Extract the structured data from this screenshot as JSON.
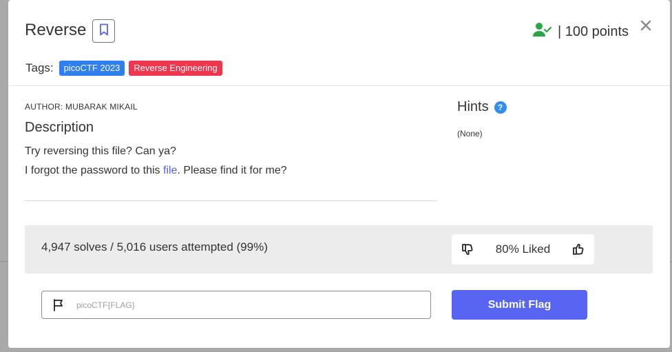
{
  "challenge": {
    "title": "Reverse",
    "points_label": "| 100 points",
    "tags_label": "Tags:",
    "tags": [
      {
        "label": "picoCTF 2023",
        "color": "#2f7ff0"
      },
      {
        "label": "Reverse Engineering",
        "color": "#f0364e"
      }
    ],
    "author": "AUTHOR: MUBARAK MIKAIL",
    "description_heading": "Description",
    "description_line1": "Try reversing this file? Can ya?",
    "description_line2_prefix": "I forgot the password to this ",
    "description_link": "file",
    "description_line2_suffix": ". Please find it for me?"
  },
  "hints": {
    "title": "Hints",
    "help_icon": "?",
    "value": "(None)"
  },
  "stats": {
    "solves_text": "4,947 solves / 5,016 users attempted (99%)",
    "liked_text": "80% Liked"
  },
  "flag_form": {
    "placeholder": "picoCTF{FLAG}",
    "submit_label": "Submit Flag"
  },
  "icons": {
    "bookmark": "bookmark-icon",
    "user_check": "user-check-icon",
    "close": "close-icon",
    "thumbs_down": "thumbs-down-icon",
    "thumbs_up": "thumbs-up-icon",
    "flag": "flag-icon"
  },
  "colors": {
    "accent": "#5865f2",
    "success": "#28a745",
    "tag_blue": "#2f7ff0",
    "tag_red": "#f0364e"
  }
}
